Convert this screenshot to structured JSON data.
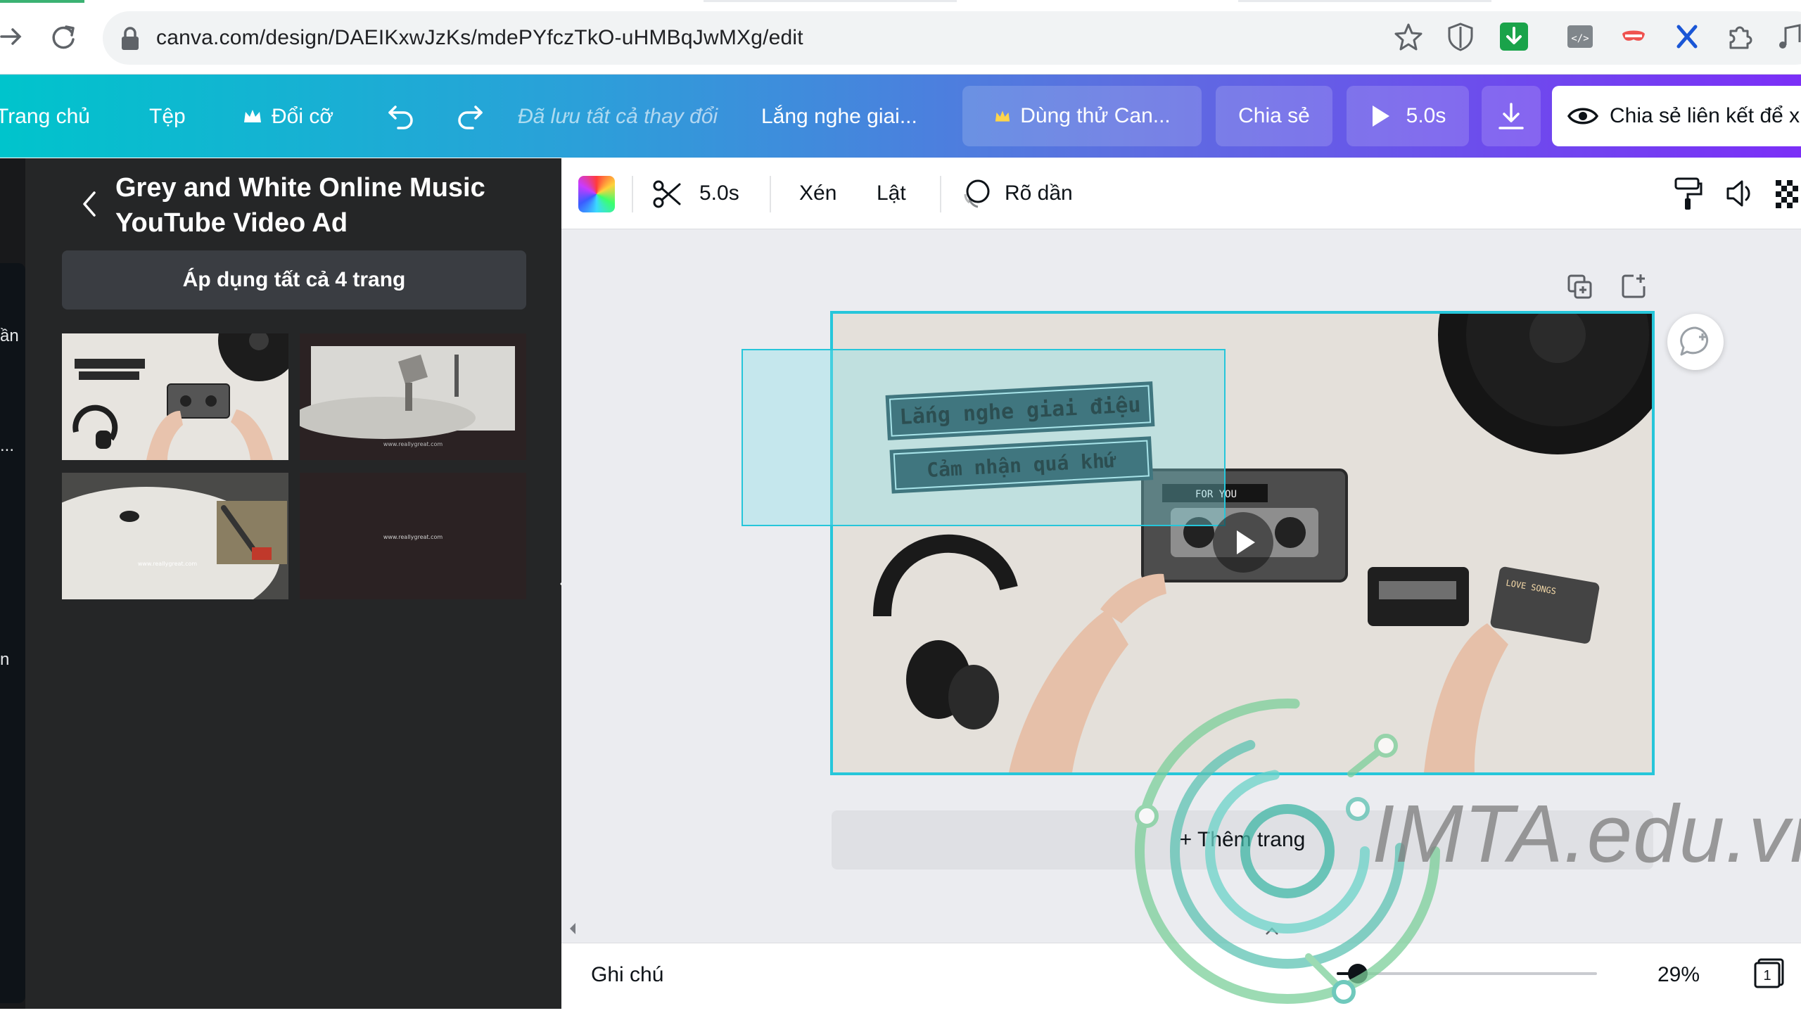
{
  "browser": {
    "url": "canva.com/design/DAEIKxwJzKs/mdePYfczTkO-uHMBqJwMXg/edit",
    "icons": [
      "forward-arrow-icon",
      "reload-icon",
      "lock-icon",
      "star-icon",
      "shield-icon",
      "download-ext-icon",
      "code-ext-icon",
      "mask-ext-icon",
      "x-ext-icon",
      "puzzle-ext-icon",
      "music-ext-icon"
    ]
  },
  "topbar": {
    "home": "Trang chủ",
    "file": "Tệp",
    "resize": "Đổi cỡ",
    "saved_status": "Đã lưu tất cả thay đổi",
    "design_title": "Lắng nghe giai...",
    "try_pro": "Dùng thử Can...",
    "share": "Chia sẻ",
    "duration": "5.0s",
    "share_link": "Chia sẻ liên kết để x"
  },
  "rail": {
    "fragments": [
      "ần",
      "...",
      "n"
    ]
  },
  "left_panel": {
    "title": "Grey and White Online Music YouTube Video Ad",
    "apply_all": "Áp dụng tất cả 4 trang",
    "thumbnails": [
      {
        "name": "page-1"
      },
      {
        "name": "page-2",
        "caption": "www.reallygreat.com"
      },
      {
        "name": "page-3",
        "caption": "www.reallygreat.com"
      },
      {
        "name": "page-4",
        "caption": "www.reallygreat.com"
      }
    ]
  },
  "context_bar": {
    "duration": "5.0s",
    "crop": "Xén",
    "flip": "Lật",
    "fade": "Rõ dần"
  },
  "canvas": {
    "line1": "Lắng nghe giai điệu",
    "line2": "Cảm nhận quá khứ",
    "cassette_label": "FOR YOU",
    "cassette_label_2": "LOVE SONGS"
  },
  "add_page": "+ Thêm trang",
  "footer": {
    "notes": "Ghi chú",
    "zoom": "29%",
    "zoom_fraction": 0.08,
    "page_count": "1"
  },
  "watermark": "IMTA.edu.vn",
  "colors": {
    "accent": "#26c6da",
    "panel_bg": "#252627",
    "header_start": "#00c4cc",
    "header_end": "#7b2ff7"
  }
}
